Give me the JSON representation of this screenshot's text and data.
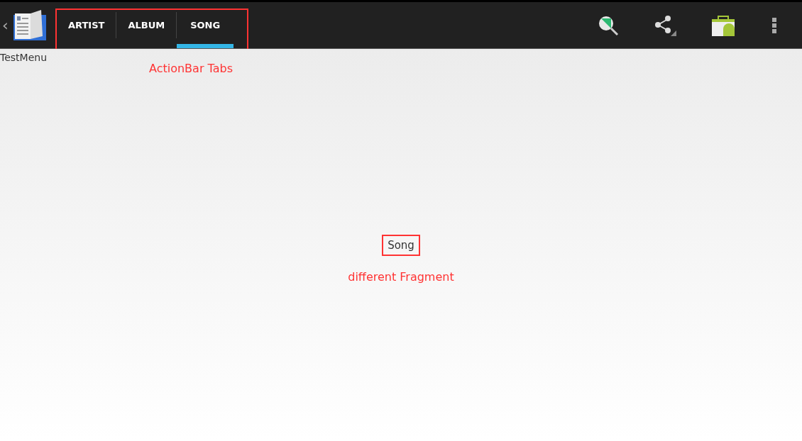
{
  "action_bar": {
    "up_caret": "‹",
    "tabs": [
      {
        "label": "ARTIST",
        "selected": false
      },
      {
        "label": "ALBUM",
        "selected": false
      },
      {
        "label": "SONG",
        "selected": true
      }
    ]
  },
  "app_label": "TestMenu",
  "fragment_text": "Song",
  "annotations": [
    {
      "kind": "tabs",
      "text": "ActionBar Tabs"
    },
    {
      "kind": "fragment",
      "text": "different Fragment"
    }
  ]
}
